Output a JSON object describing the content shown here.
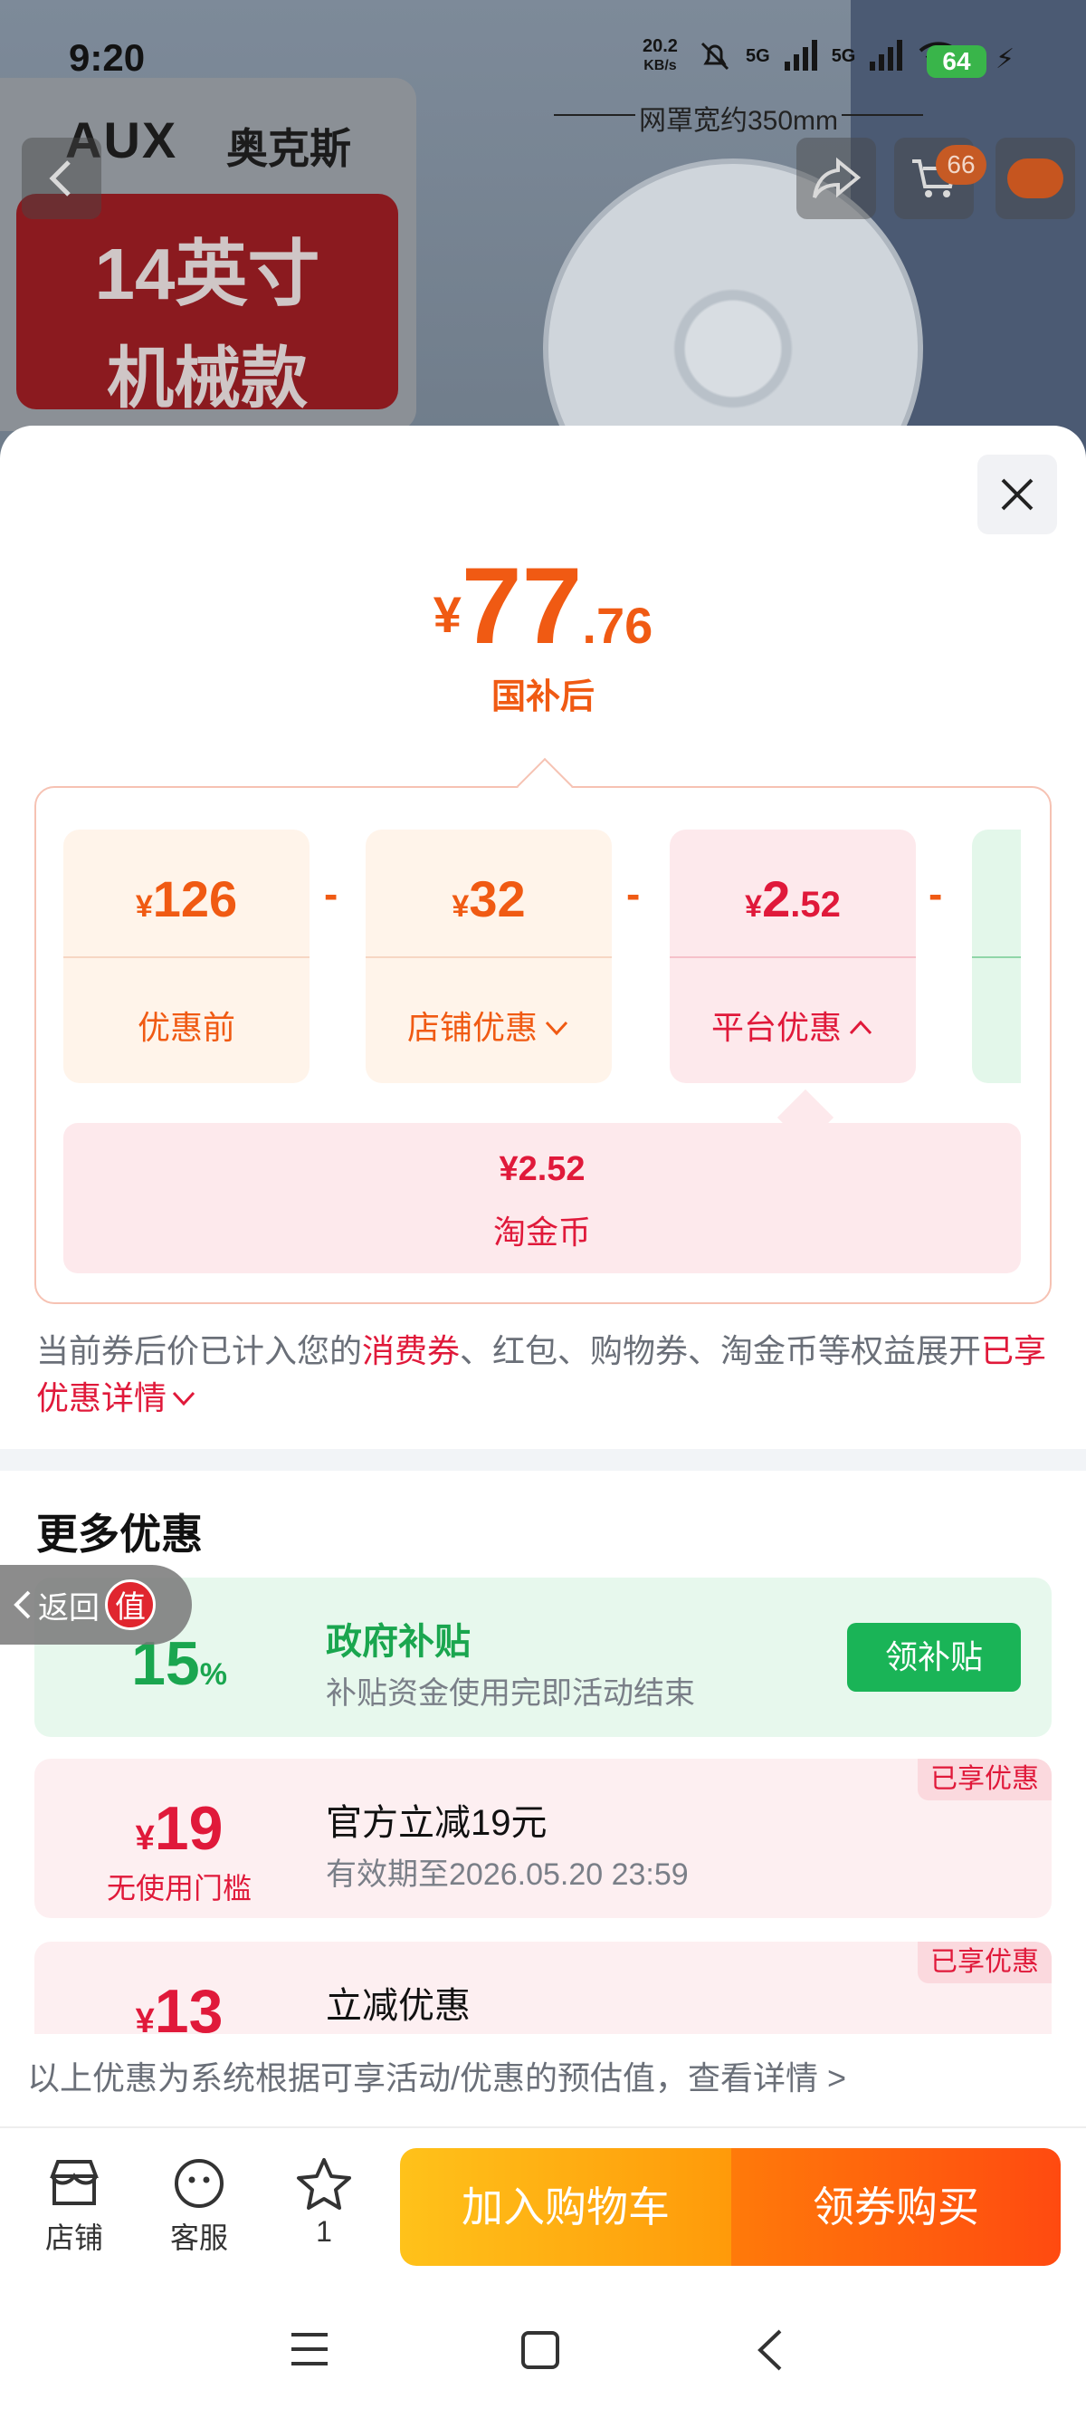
{
  "status_bar": {
    "time": "9:20",
    "net_speed": "20.2",
    "net_unit": "KB/s",
    "signal1": "5G",
    "signal2": "5G",
    "battery": "64"
  },
  "product_hero": {
    "brand": "AUX",
    "brand_cn": "奥克斯",
    "badge_line1": "14英寸",
    "badge_line2": "机械款",
    "dimension": "网罩宽约350mm",
    "cart_count": "66"
  },
  "price": {
    "currency": "¥",
    "integer": "77",
    "decimal": ".76",
    "label": "国补后"
  },
  "breakdown": {
    "cards": [
      {
        "currency": "¥",
        "value": "126",
        "label": "优惠前",
        "has_chevron": false
      },
      {
        "currency": "¥",
        "value": "32",
        "label": "店铺优惠",
        "has_chevron": true,
        "chevron": "down"
      },
      {
        "currency": "¥",
        "value_int": "2",
        "value_dec": ".52",
        "label": "平台优惠",
        "has_chevron": true,
        "chevron": "up"
      }
    ],
    "operator": "-",
    "detail": {
      "amount": "¥2.52",
      "name": "淘金币"
    }
  },
  "note": {
    "prefix": "当前券后价已计入您的",
    "highlight": "消费券",
    "middle": "、红包、购物券、淘金币等权益展开",
    "link": "已享优惠详情"
  },
  "more_offers": {
    "title": "更多优惠",
    "items": [
      {
        "big": "15",
        "unit": "%",
        "title": "政府补贴",
        "sub": "补贴资金使用完即活动结束",
        "button": "领补贴"
      },
      {
        "currency": "¥",
        "big": "19",
        "small": "无使用门槛",
        "title": "官方立减19元",
        "sub": "有效期至2026.05.20 23:59",
        "tag": "已享优惠"
      },
      {
        "currency": "¥",
        "big": "13",
        "title": "立减优惠",
        "tag": "已享优惠"
      }
    ]
  },
  "back_float": {
    "label": "返回",
    "badge": "值"
  },
  "disclaimer": "以上优惠为系统根据可享活动/优惠的预估值，查看详情 >",
  "bottom_bar": {
    "shop": "店铺",
    "service": "客服",
    "favorites_count": "1",
    "add_to_cart": "加入购物车",
    "buy": "领券购买"
  },
  "colors": {
    "accent_orange": "#f05a13",
    "accent_red": "#e0193a",
    "green": "#1ab457"
  }
}
